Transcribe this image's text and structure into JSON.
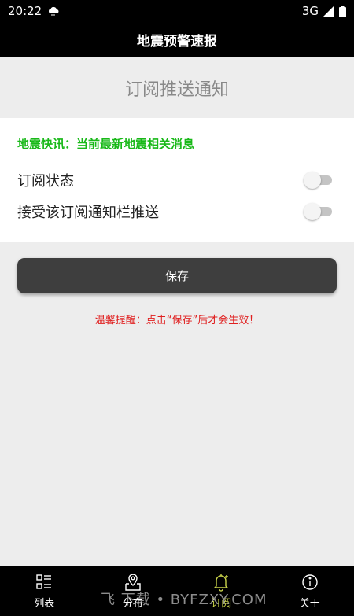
{
  "status_bar": {
    "time": "20:22",
    "network": "3G",
    "icons": [
      "cloud-icon",
      "signal-icon",
      "battery-icon"
    ]
  },
  "header": {
    "title": "地震预警速报"
  },
  "section": {
    "title": "订阅推送通知"
  },
  "card": {
    "notice": "地震快讯：当前最新地震相关消息",
    "notice_color": "#19b919",
    "rows": [
      {
        "label": "订阅状态",
        "enabled": false
      },
      {
        "label": "接受该订阅通知栏推送",
        "enabled": false
      }
    ]
  },
  "save_button": {
    "label": "保存"
  },
  "tip": {
    "text": "温馨提醒：点击“保存”后才会生效！",
    "color": "#e02020"
  },
  "tab_bar": {
    "tabs": [
      {
        "label": "列表",
        "icon": "list-icon",
        "active": false
      },
      {
        "label": "分布",
        "icon": "map-pin-icon",
        "active": false
      },
      {
        "label": "订阅",
        "icon": "bell-icon",
        "active": true
      },
      {
        "label": "关于",
        "icon": "info-icon",
        "active": false
      }
    ],
    "active_color": "#c8d24a"
  },
  "watermark": {
    "text": "飞 下载 • BYFZXY.COM"
  }
}
